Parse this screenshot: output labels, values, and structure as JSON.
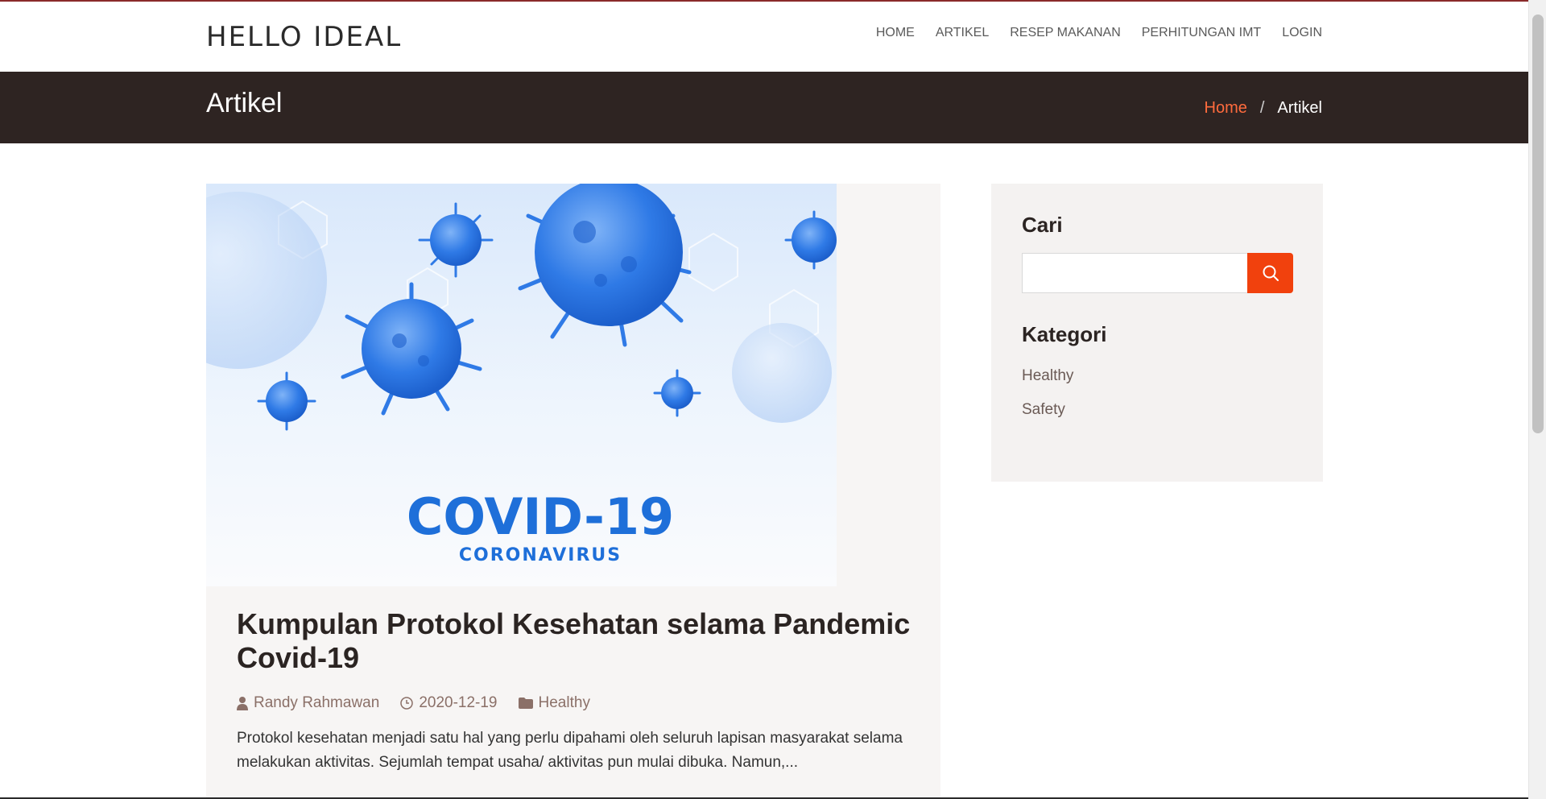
{
  "header": {
    "brand": "HELLO IDEAL",
    "nav": [
      "HOME",
      "ARTIKEL",
      "RESEP MAKANAN",
      "PERHITUNGAN IMT",
      "LOGIN"
    ]
  },
  "title_bar": {
    "title": "Artikel",
    "breadcrumb_home": "Home",
    "breadcrumb_sep": "/",
    "breadcrumb_current": "Artikel"
  },
  "article": {
    "image_text_main": "COVID-19",
    "image_text_sub": "CORONAVIRUS",
    "title": "Kumpulan Protokol Kesehatan selama Pandemic Covid-19",
    "author": "Randy Rahmawan",
    "date": "2020-12-19",
    "category": "Healthy",
    "excerpt": "Protokol kesehatan menjadi satu hal yang perlu dipahami oleh seluruh lapisan masyarakat selama melakukan aktivitas. Sejumlah tempat usaha/ aktivitas pun mulai dibuka. Namun,..."
  },
  "sidebar": {
    "search_title": "Cari",
    "search_value": "",
    "category_title": "Kategori",
    "categories": [
      "Healthy",
      "Safety"
    ]
  },
  "colors": {
    "accent": "#f1410d",
    "title_bar": "#2e2422",
    "breadcrumb_link": "#ff6b3d"
  }
}
